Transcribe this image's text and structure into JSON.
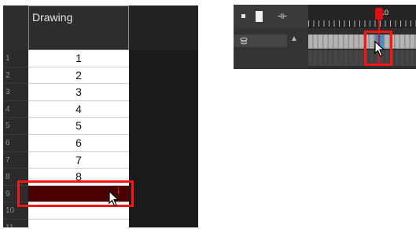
{
  "xsheet": {
    "column_header": "Drawing",
    "rows": [
      {
        "num": "1",
        "value": "1"
      },
      {
        "num": "2",
        "value": "2"
      },
      {
        "num": "3",
        "value": "3"
      },
      {
        "num": "4",
        "value": "4"
      },
      {
        "num": "5",
        "value": "5"
      },
      {
        "num": "6",
        "value": "6"
      },
      {
        "num": "7",
        "value": "7"
      },
      {
        "num": "8",
        "value": "8"
      },
      {
        "num": "9",
        "value": ""
      },
      {
        "num": "10",
        "value": ""
      },
      {
        "num": "11",
        "value": ""
      }
    ],
    "selected_row_num": "9",
    "drag_arrow": "↓"
  },
  "timeline": {
    "frame_label": "10",
    "sync_icon": "⟛",
    "scroll_up": "▲"
  },
  "colors": {
    "highlight": "#ff1414",
    "selected_cell": "#4a0000",
    "timeline_selected": "#3a90c8",
    "playhead": "#e01010"
  }
}
